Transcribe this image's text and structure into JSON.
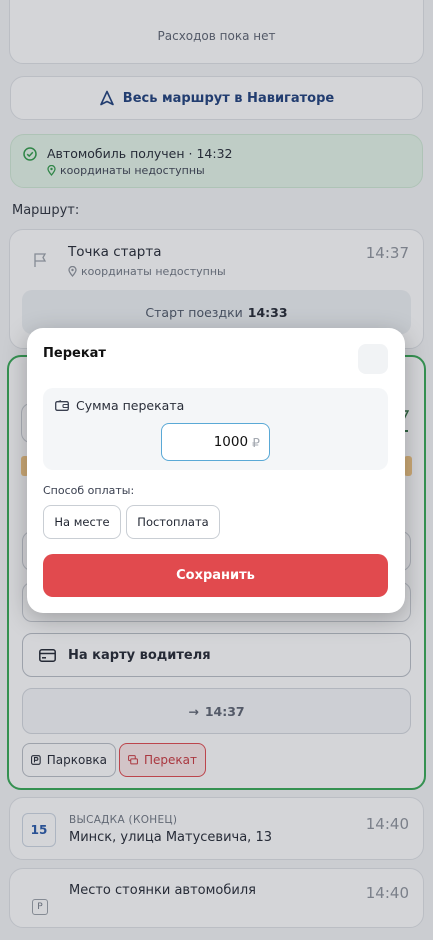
{
  "expenses": {
    "empty_text": "Расходов пока нет"
  },
  "navigator": {
    "label": "Весь маршрут в Навигаторе"
  },
  "car_received": {
    "title": "Автомобиль получен · 14:32",
    "coords": "координаты недоступны"
  },
  "route": {
    "label": "Маршрут:",
    "start": {
      "name": "Точка старта",
      "coords": "координаты недоступны",
      "time": "14:37",
      "trip_label": "Старт поездки",
      "trip_time": "14:33"
    }
  },
  "active_stop": {
    "driver_card_label": "На карту водителя",
    "arrive_time": "14:37",
    "parking_chip": "Парковка",
    "perekat_chip": "Перекат"
  },
  "dropoff": {
    "day": "15",
    "kind": "ВЫСАДКА (КОНЕЦ)",
    "address": "Минск, улица Матусевича, 13",
    "time": "14:40"
  },
  "parking_place": {
    "name": "Место стоянки автомобиля",
    "time": "14:40"
  },
  "modal": {
    "title": "Перекат",
    "amount_label": "Сумма переката",
    "amount_value": "1000",
    "currency": "₽",
    "payment_label": "Способ оплаты:",
    "payment_options": [
      "На месте",
      "Постоплата"
    ],
    "save_label": "Сохранить"
  },
  "colors": {
    "accent_red": "#e14a4e",
    "active_green": "#34a853",
    "navigator_blue": "#1c3d7a"
  }
}
